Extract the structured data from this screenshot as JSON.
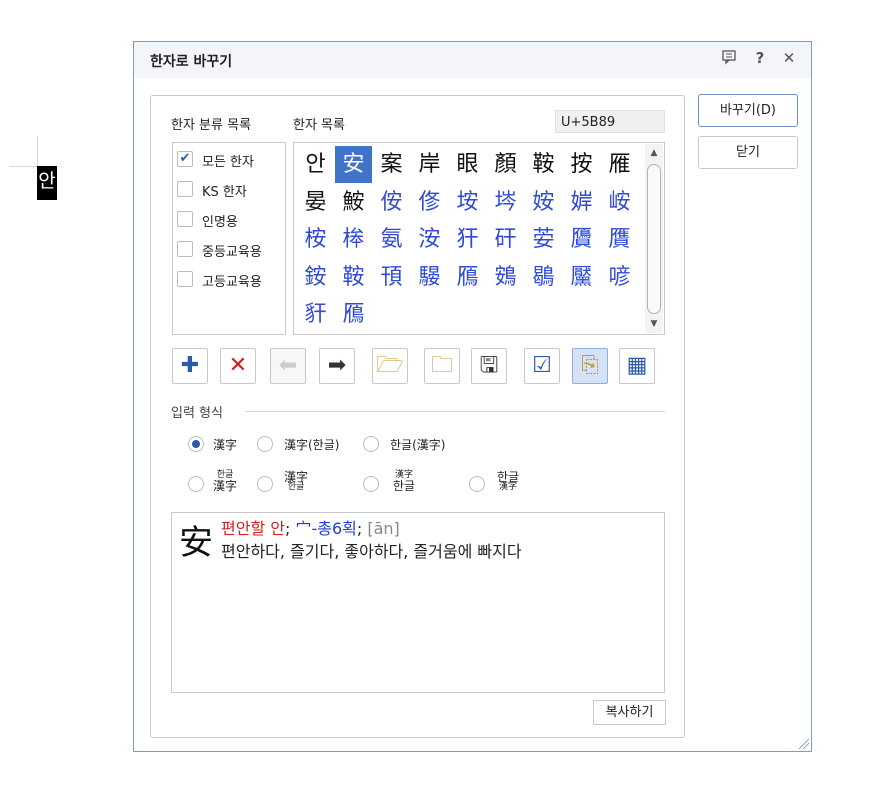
{
  "document": {
    "selected_char": "안"
  },
  "dialog": {
    "title": "한자로 바꾸기",
    "titlebar_icons": [
      "comment-icon",
      "help-icon",
      "close-icon"
    ],
    "help_glyph": "?",
    "close_glyph": "✕",
    "labels": {
      "category_list": "한자 분류 목록",
      "hanja_list": "한자 목록"
    },
    "unicode_value": "U+5B89",
    "categories": [
      {
        "label": "모든 한자",
        "checked": true
      },
      {
        "label": "KS 한자",
        "checked": false
      },
      {
        "label": "인명용",
        "checked": false
      },
      {
        "label": "중등교육용",
        "checked": false
      },
      {
        "label": "고등교육용",
        "checked": false
      }
    ],
    "hanja": [
      {
        "ch": "안",
        "color": "black"
      },
      {
        "ch": "安",
        "color": "selected"
      },
      {
        "ch": "案",
        "color": "black"
      },
      {
        "ch": "岸",
        "color": "black"
      },
      {
        "ch": "眼",
        "color": "black"
      },
      {
        "ch": "顏",
        "color": "black"
      },
      {
        "ch": "鞍",
        "color": "black"
      },
      {
        "ch": "按",
        "color": "black"
      },
      {
        "ch": "雁",
        "color": "black"
      },
      {
        "ch": "晏",
        "color": "black"
      },
      {
        "ch": "鮟",
        "color": "black"
      },
      {
        "ch": "侒",
        "color": "blue"
      },
      {
        "ch": "俢",
        "color": "blue"
      },
      {
        "ch": "垵",
        "color": "blue"
      },
      {
        "ch": "埁",
        "color": "blue"
      },
      {
        "ch": "姲",
        "color": "blue"
      },
      {
        "ch": "婩",
        "color": "blue"
      },
      {
        "ch": "峖",
        "color": "blue"
      },
      {
        "ch": "桉",
        "color": "blue"
      },
      {
        "ch": "桳",
        "color": "blue"
      },
      {
        "ch": "氨",
        "color": "blue"
      },
      {
        "ch": "洝",
        "color": "blue"
      },
      {
        "ch": "犴",
        "color": "blue"
      },
      {
        "ch": "矸",
        "color": "blue"
      },
      {
        "ch": "荌",
        "color": "blue"
      },
      {
        "ch": "贗",
        "color": "blue"
      },
      {
        "ch": "贋",
        "color": "blue"
      },
      {
        "ch": "銨",
        "color": "blue"
      },
      {
        "ch": "鞍",
        "color": "blue"
      },
      {
        "ch": "頇",
        "color": "blue"
      },
      {
        "ch": "騴",
        "color": "blue"
      },
      {
        "ch": "鴈",
        "color": "blue"
      },
      {
        "ch": "鴳",
        "color": "blue"
      },
      {
        "ch": "鶡",
        "color": "blue"
      },
      {
        "ch": "黶",
        "color": "blue"
      },
      {
        "ch": "喭",
        "color": "blue"
      },
      {
        "ch": "豻",
        "color": "blue"
      },
      {
        "ch": "鴈",
        "color": "blue"
      }
    ],
    "toolbar": [
      {
        "name": "add-icon",
        "glyph": "✚",
        "state": "normal",
        "color": "#2b5aa8"
      },
      {
        "name": "delete-icon",
        "glyph": "✕",
        "state": "normal",
        "color": "#d42020"
      },
      {
        "name": "arrow-left-icon",
        "glyph": "⬅",
        "state": "disabled",
        "color": "#cccccc"
      },
      {
        "name": "arrow-right-icon",
        "glyph": "➡",
        "state": "normal",
        "color": "#333333"
      },
      {
        "name": "open-folder-icon",
        "glyph": "🗁",
        "state": "normal",
        "color": "#c8962a"
      },
      {
        "name": "folder-icon",
        "glyph": "🗀",
        "state": "normal",
        "color": "#c8962a"
      },
      {
        "name": "save-icon",
        "glyph": "🖫",
        "state": "normal",
        "color": "#333333"
      },
      {
        "name": "checklist-icon",
        "glyph": "☑",
        "state": "normal",
        "color": "#2b5aa8"
      },
      {
        "name": "dictionary-check-icon",
        "glyph": "⎘",
        "state": "active",
        "color": "#c8962a"
      },
      {
        "name": "convert-table-icon",
        "glyph": "▦",
        "state": "normal",
        "color": "#2b5aa8"
      }
    ],
    "input_format": {
      "title": "입력 형식",
      "row1": [
        {
          "label": "漢字",
          "selected": true
        },
        {
          "label": "漢字(한글)",
          "selected": false
        },
        {
          "label": "한글(漢字)",
          "selected": false
        }
      ],
      "row2": [
        {
          "top": "한글",
          "bottom": "漢字"
        },
        {
          "top": "漢字",
          "bottom": "한글"
        },
        {
          "top": "漢字",
          "bottom": "한글"
        },
        {
          "top": "한글",
          "bottom": "漢字"
        }
      ]
    },
    "info": {
      "char": "安",
      "meaning_sound": "편안할 안",
      "sep1": ";",
      "radical": "宀-총6획",
      "sep2": ";",
      "pinyin": "[ān]",
      "definition": "편안하다, 즐기다, 좋아하다, 즐거움에 빠지다"
    },
    "copy_button": "복사하기",
    "replace_button": "바꾸기(D)",
    "close_button": "닫기"
  }
}
